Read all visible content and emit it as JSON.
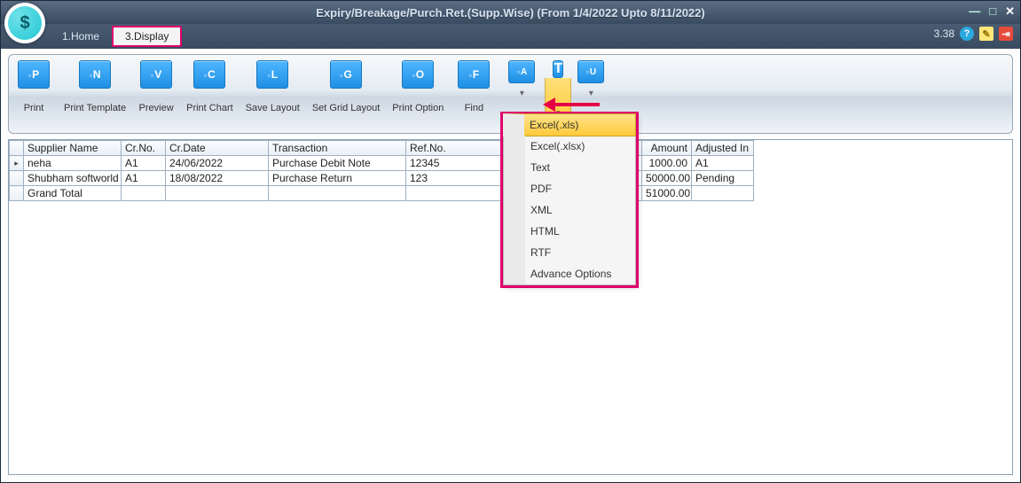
{
  "window": {
    "title": "Expiry/Breakage/Purch.Ret.(Supp.Wise) (From 1/4/2022 Upto 8/11/2022)",
    "version": "3.38"
  },
  "menu": {
    "home": "1.Home",
    "display": "3.Display"
  },
  "toolbar": {
    "print": "Print",
    "print_template": "Print Template",
    "preview": "Preview",
    "print_chart": "Print Chart",
    "save_layout": "Save Layout",
    "set_grid_layout": "Set Grid Layout",
    "print_option": "Print Option",
    "find": "Find",
    "keys": {
      "p": "P",
      "n": "N",
      "v": "V",
      "c": "C",
      "l": "L",
      "g": "G",
      "o": "O",
      "f": "F",
      "a": "A",
      "t": "T",
      "u": "U"
    }
  },
  "export_menu": {
    "xls": "Excel(.xls)",
    "xlsx": "Excel(.xlsx)",
    "text": "Text",
    "pdf": "PDF",
    "xml": "XML",
    "html": "HTML",
    "rtf": "RTF",
    "advance": "Advance Options"
  },
  "grid": {
    "headers": {
      "supplier": "Supplier Name",
      "crno": "Cr.No.",
      "crdate": "Cr.Date",
      "transaction": "Transaction",
      "refno": "Ref.No.",
      "amount": "Amount",
      "adjusted": "Adjusted In"
    },
    "rows": [
      {
        "supplier": "neha",
        "crno": "A1",
        "crdate": "24/06/2022",
        "transaction": "Purchase Debit Note",
        "refno": "12345",
        "amount": "1000.00",
        "adjusted": "A1"
      },
      {
        "supplier": "Shubham softworld",
        "crno": "A1",
        "crdate": "18/08/2022",
        "transaction": "Purchase Return",
        "refno": "123",
        "amount": "50000.00",
        "adjusted": "Pending"
      }
    ],
    "total_label": "Grand Total",
    "total_amount": "51000.00"
  }
}
